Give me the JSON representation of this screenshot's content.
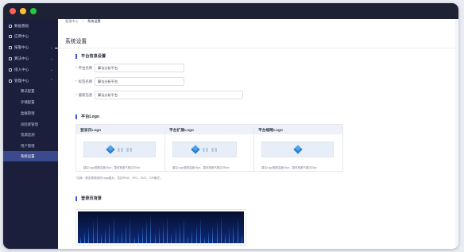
{
  "sidebar": {
    "items": [
      {
        "label": "数据看板",
        "chevron": ""
      },
      {
        "label": "应用中心",
        "chevron": ""
      },
      {
        "label": "报警中心",
        "chevron": "⌄"
      },
      {
        "label": "算法中心",
        "chevron": "⌄"
      },
      {
        "label": "接入中心",
        "chevron": "⌄"
      },
      {
        "label": "管理中心",
        "chevron": "⌃"
      }
    ],
    "subitems": [
      {
        "label": "算法配置"
      },
      {
        "label": "存储配置"
      },
      {
        "label": "盒群管理"
      },
      {
        "label": "风险库管理"
      },
      {
        "label": "资源监测"
      },
      {
        "label": "用户管理"
      },
      {
        "label": "系统设置"
      }
    ]
  },
  "breadcrumb": {
    "parent": "管理中心",
    "separator": "/",
    "current": "系统设置"
  },
  "page": {
    "title": "系统设置"
  },
  "info_section": {
    "title": "平台信息设置",
    "fields": [
      {
        "label": "平台名称",
        "value": "算法分析平台"
      },
      {
        "label": "标签名称",
        "value": "算法分析平台"
      },
      {
        "label": "版权信息",
        "value": "算法分析平台"
      }
    ]
  },
  "logo_section": {
    "title": "平台Logo",
    "cards": [
      {
        "title": "登录页Logo",
        "hint": "建议Logo图宽高度40px，整体宽度不超过200px"
      },
      {
        "title": "平台扩展Logo",
        "hint": "建议Logo图宽高度40px，整体宽度不超过180px"
      },
      {
        "title": "平台缩略Logo",
        "hint": "建议Logo图宽高度40px，整体宽度不超过40px"
      }
    ],
    "note": "*注释：请选择使用的Logo图片，支持PNG、JPG、SVG、GIF格式。"
  },
  "bg_section": {
    "title": "登录页背景"
  },
  "colors": {
    "sidebar": "#1b1f3b",
    "accent": "#3b5bdb",
    "active_item": "#3b4a8c"
  }
}
